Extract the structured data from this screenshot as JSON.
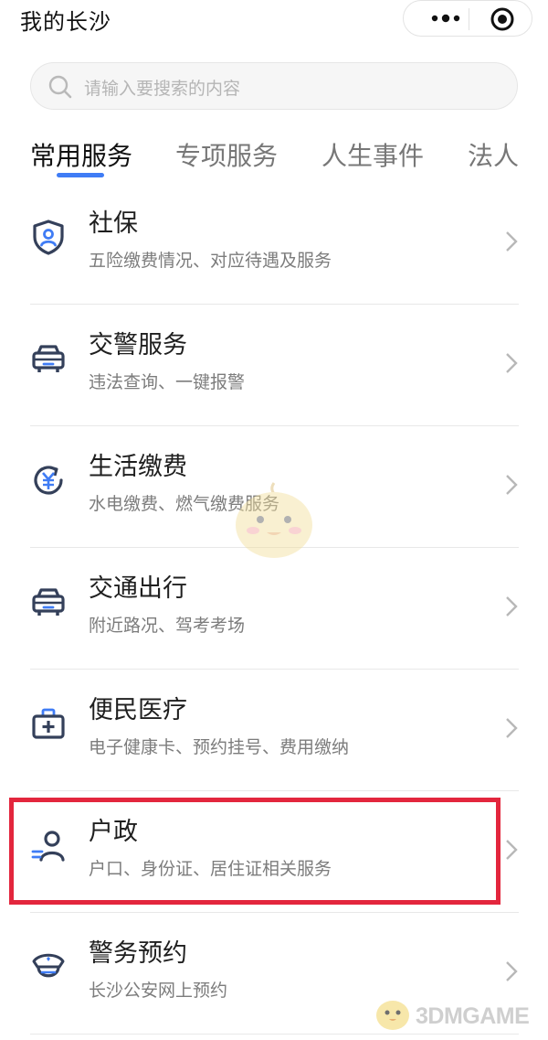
{
  "header": {
    "title": "我的长沙"
  },
  "search": {
    "placeholder": "请输入要搜索的内容"
  },
  "tabs": [
    {
      "label": "常用服务",
      "active": true
    },
    {
      "label": "专项服务",
      "active": false
    },
    {
      "label": "人生事件",
      "active": false
    },
    {
      "label": "法人",
      "active": false
    }
  ],
  "services": [
    {
      "title": "社保",
      "subtitle": "五险缴费情况、对应待遇及服务",
      "icon": "shield-person-icon"
    },
    {
      "title": "交警服务",
      "subtitle": "违法查询、一键报警",
      "icon": "car-icon"
    },
    {
      "title": "生活缴费",
      "subtitle": "水电缴费、燃气缴费服务",
      "icon": "yuan-refresh-icon"
    },
    {
      "title": "交通出行",
      "subtitle": "附近路况、驾考考场",
      "icon": "car-icon"
    },
    {
      "title": "便民医疗",
      "subtitle": "电子健康卡、预约挂号、费用缴纳",
      "icon": "medical-kit-icon"
    },
    {
      "title": "户政",
      "subtitle": "户口、身份证、居住证相关服务",
      "icon": "person-list-icon",
      "highlighted": true
    },
    {
      "title": "警务预约",
      "subtitle": "长沙公安网上预约",
      "icon": "police-cap-icon"
    }
  ],
  "watermark": {
    "text": "3DMGAME"
  },
  "colors": {
    "accent": "#3f7cf5",
    "icon_dark": "#34405a",
    "highlight": "#e3263d"
  }
}
